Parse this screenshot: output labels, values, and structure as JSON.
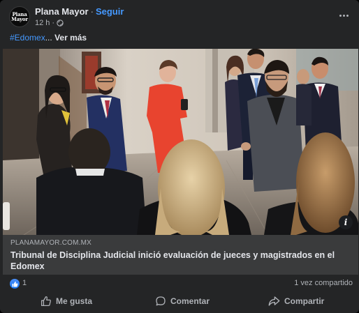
{
  "post": {
    "page_name": "Plana Mayor",
    "separator": "·",
    "follow_label": "Seguir",
    "time": "12 h",
    "time_separator": "·",
    "audience_icon": "globe-icon",
    "avatar_logo": [
      "Plana",
      "Mayor"
    ],
    "more_icon": "more-horizontal-icon"
  },
  "caption": {
    "hashtag": "#Edomex",
    "ellipsis": "...",
    "see_more": "Ver más"
  },
  "photo": {
    "info_icon": "info-icon",
    "info_glyph": "i"
  },
  "link_preview": {
    "domain": "PLANAMAYOR.COM.MX",
    "title": "Tribunal de Disciplina Judicial inició evaluación de jueces y magistrados en el Edomex"
  },
  "stats": {
    "reaction_icon": "like-reaction-icon",
    "reaction_count": "1",
    "shares": "1 vez compartido"
  },
  "actions": {
    "like": "Me gusta",
    "comment": "Comentar",
    "share": "Compartir"
  },
  "colors": {
    "card_bg": "#242526",
    "link_bg": "#3a3b3c",
    "accent": "#4599ff",
    "like_blue": "#1877f2",
    "dress_red": "#e8442f"
  }
}
